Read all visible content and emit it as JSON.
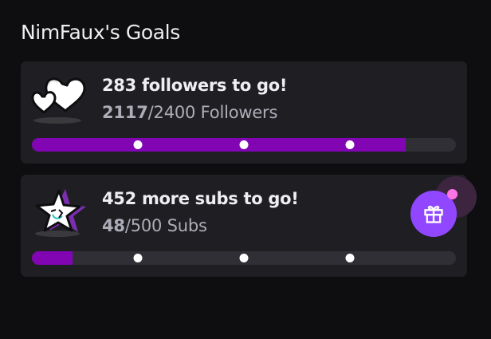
{
  "title": "NimFaux's Goals",
  "goals": [
    {
      "icon": "hearts-icon",
      "headline": "283 followers to go!",
      "current": "2117",
      "separator": "/",
      "target_text": "2400 Followers",
      "progress": 0.882,
      "milestones": [
        0.25,
        0.5,
        0.75
      ]
    },
    {
      "icon": "star-icon",
      "headline": "452 more subs to go!",
      "current": "48",
      "separator": "/",
      "target_text": "500 Subs",
      "progress": 0.096,
      "milestones": [
        0.25,
        0.5,
        0.75
      ]
    }
  ],
  "gift": {
    "icon": "gift-icon",
    "notification": true
  },
  "colors": {
    "background": "#0e0e10",
    "card": "#1f1f23",
    "bar_track": "#2f2f35",
    "bar_fill": "#8205b4",
    "gift_button": "#9147ff",
    "notification_dot": "#ff75e6"
  }
}
